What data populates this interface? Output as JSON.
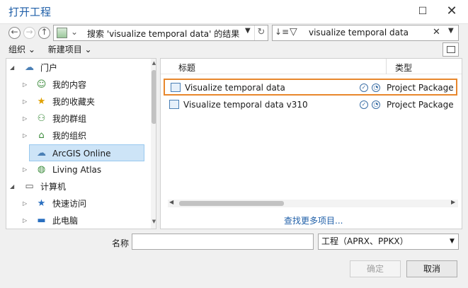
{
  "window": {
    "title": "打开工程"
  },
  "address": {
    "path": "搜索 'visualize temporal data' 的结果"
  },
  "search": {
    "value": "visualize temporal data"
  },
  "toolbar": {
    "organize": "组织 ⌄",
    "new_item": "新建项目 ⌄"
  },
  "tree": {
    "items": [
      {
        "label": "门户",
        "icon": "cloud-icon"
      },
      {
        "label": "我的内容",
        "icon": "person-icon"
      },
      {
        "label": "我的收藏夹",
        "icon": "star-icon"
      },
      {
        "label": "我的群组",
        "icon": "group-icon"
      },
      {
        "label": "我的组织",
        "icon": "org-icon"
      },
      {
        "label": "ArcGIS Online",
        "icon": "cloud-icon"
      },
      {
        "label": "Living Atlas",
        "icon": "globe-icon"
      },
      {
        "label": "计算机",
        "icon": "computer-icon"
      },
      {
        "label": "快速访问",
        "icon": "pin-icon"
      },
      {
        "label": "此电脑",
        "icon": "monitor-icon"
      }
    ]
  },
  "list": {
    "columns": [
      "标题",
      "类型"
    ],
    "rows": [
      {
        "name": "Visualize temporal data",
        "type": "Project Package"
      },
      {
        "name": "Visualize temporal data v310",
        "type": "Project Package"
      }
    ],
    "find_more": "查找更多项目..."
  },
  "footer": {
    "name_label": "名称",
    "name_value": "",
    "filetype": "工程（APRX、PPKX）",
    "ok": "确定",
    "cancel": "取消"
  },
  "colors": {
    "accent": "#1f5fa8",
    "highlight": "#e8872c",
    "selected": "#cde4f7"
  }
}
